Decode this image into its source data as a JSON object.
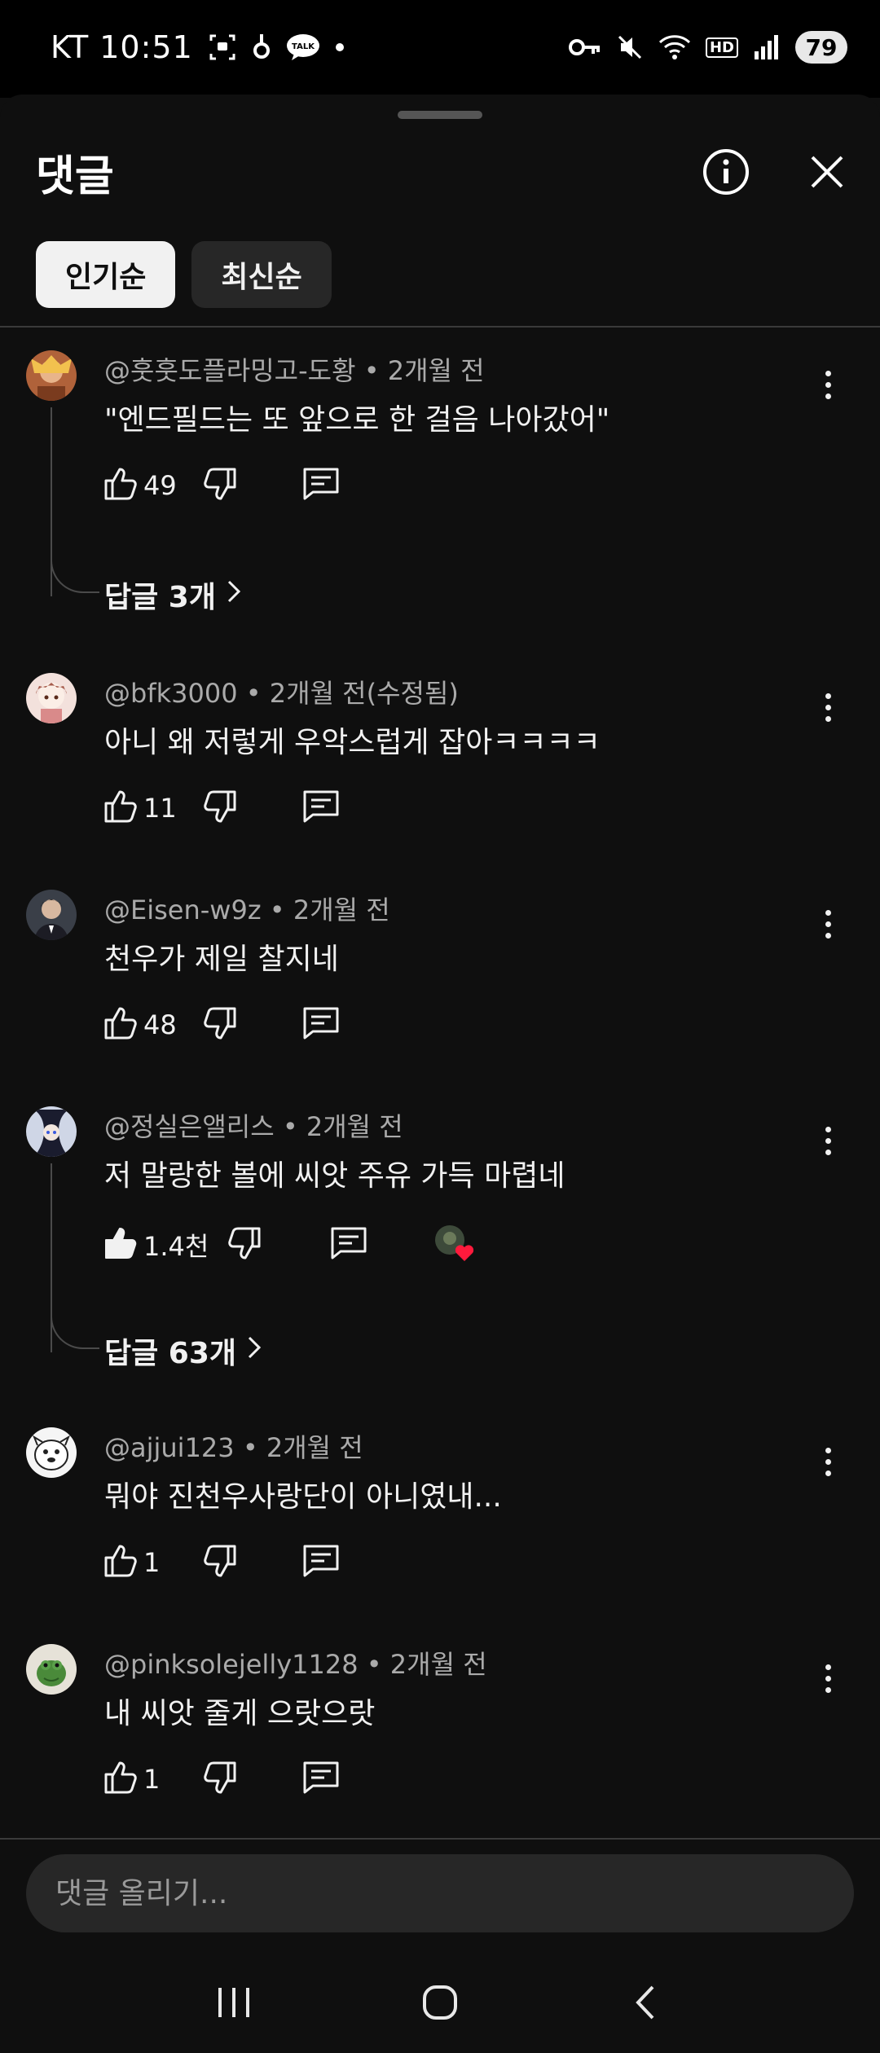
{
  "status_bar": {
    "carrier_time": "KT 10:51",
    "battery": "79",
    "hd_label": "HD"
  },
  "header": {
    "title": "댓글",
    "info_icon": "info-icon",
    "close_icon": "close-icon"
  },
  "sort_chips": [
    {
      "label": "인기순",
      "active": true
    },
    {
      "label": "최신순",
      "active": false
    }
  ],
  "comments": [
    {
      "author": "@훗훗도플라밍고-도황",
      "time": "2개월 전",
      "text": "\"엔드필드는 또 앞으로 한 걸음 나아갔어\"",
      "likes": "49",
      "replies_label": "답글 3개"
    },
    {
      "author": "@bfk3000",
      "time": "2개월 전(수정됨)",
      "text": "아니 왜 저렇게 우악스럽게 잡아ㅋㅋㅋㅋ",
      "likes": "11"
    },
    {
      "author": "@Eisen-w9z",
      "time": "2개월 전",
      "text": "천우가 제일 찰지네",
      "likes": "48"
    },
    {
      "author": "@정실은앨리스",
      "time": "2개월 전",
      "text": "저 말랑한 볼에 씨앗 주유 가득 마렵네",
      "likes": "1.4천",
      "replies_label": "답글 63개",
      "liked": true,
      "creator_heart": true
    },
    {
      "author": "@ajjui123",
      "time": "2개월 전",
      "text": "뭐야 진천우사랑단이 아니였내...",
      "likes": "1"
    },
    {
      "author": "@pinksolejelly1128",
      "time": "2개월 전",
      "text": "내 씨앗 줄게 으랏으랏",
      "likes": "1"
    }
  ],
  "input": {
    "placeholder": "댓글 올리기..."
  },
  "colors": {
    "background": "#0f0f0f",
    "chip_active": "#f1f1f1",
    "chip_inactive": "#272727",
    "meta_text": "#aaaaaa",
    "heart": "#ff1a3c"
  }
}
